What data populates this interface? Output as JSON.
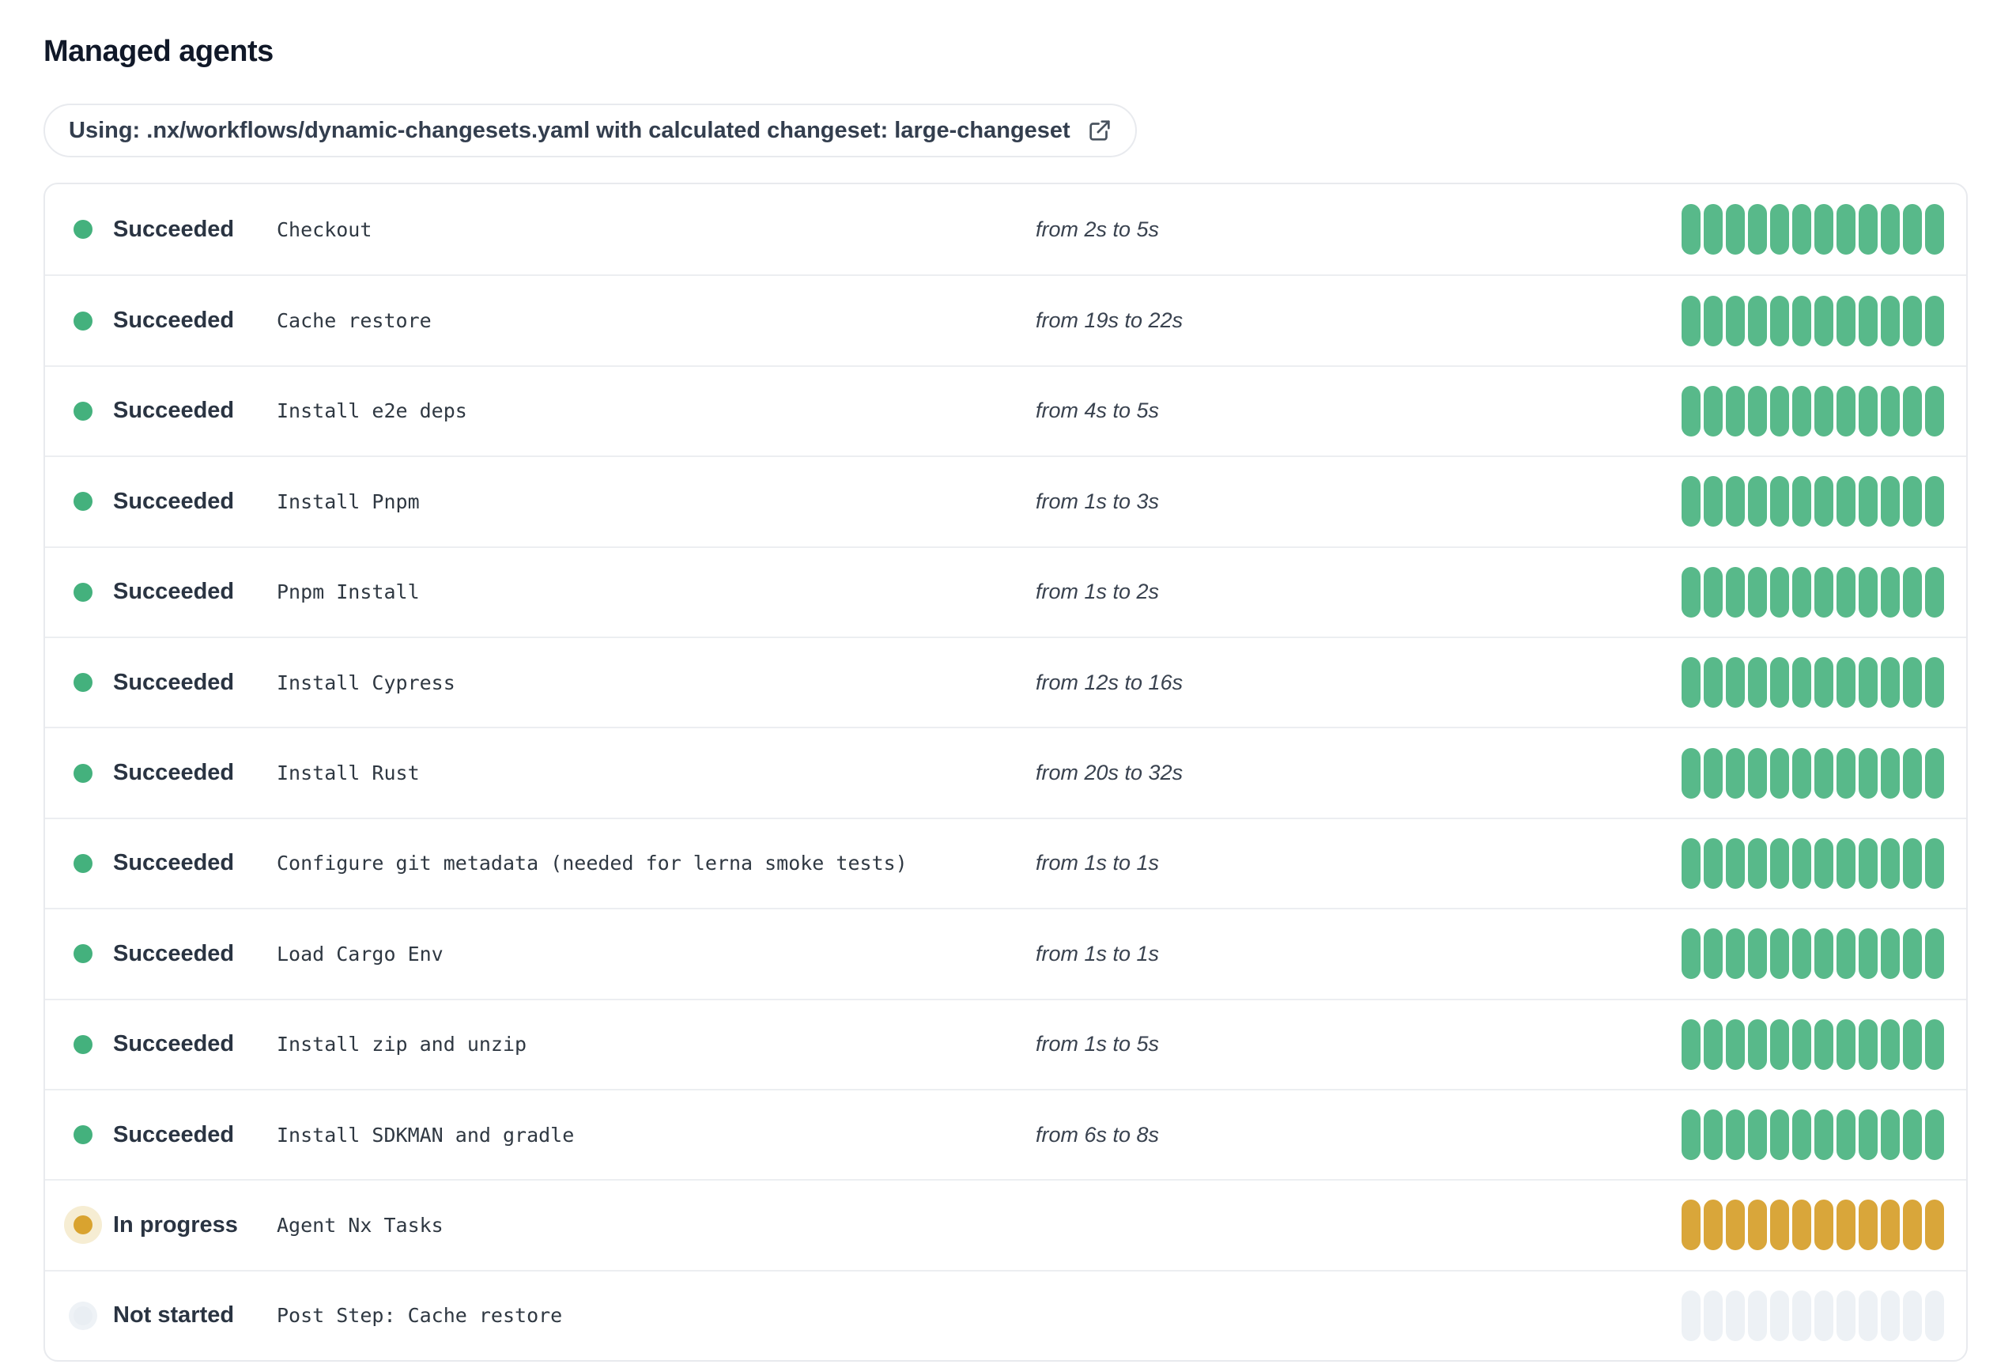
{
  "page": {
    "title": "Managed agents"
  },
  "workflow_badge": {
    "label": "Using: .nx/workflows/dynamic-changesets.yaml with calculated changeset: large-changeset",
    "icon": "external-link-icon"
  },
  "colors": {
    "title_text": "#101828",
    "badge_text": "#333E4E",
    "badge_border": "#E8EAEE",
    "panel_border": "#E8EAEE",
    "row_divider": "#ECEEF1",
    "status_text": "#2A3442",
    "step_text": "#2F3842",
    "duration_text": "#39424F",
    "succeeded_dot": "#44B17D",
    "succeeded_bar": "#58B98A",
    "in_progress_dot": "#D9A32F",
    "in_progress_halo": "#F6EDD3",
    "in_progress_bar": "#D9A63A",
    "not_started_dot": "#E9EEF3",
    "not_started_bar": "#EDF1F5"
  },
  "agents": {
    "segments_per_bar": 12,
    "rows": [
      {
        "status": "succeeded",
        "status_label": "Succeeded",
        "step": "Checkout",
        "duration": "from 2s to 5s"
      },
      {
        "status": "succeeded",
        "status_label": "Succeeded",
        "step": "Cache restore",
        "duration": "from 19s to 22s"
      },
      {
        "status": "succeeded",
        "status_label": "Succeeded",
        "step": "Install e2e deps",
        "duration": "from 4s to 5s"
      },
      {
        "status": "succeeded",
        "status_label": "Succeeded",
        "step": "Install Pnpm",
        "duration": "from 1s to 3s"
      },
      {
        "status": "succeeded",
        "status_label": "Succeeded",
        "step": "Pnpm Install",
        "duration": "from 1s to 2s"
      },
      {
        "status": "succeeded",
        "status_label": "Succeeded",
        "step": "Install Cypress",
        "duration": "from 12s to 16s"
      },
      {
        "status": "succeeded",
        "status_label": "Succeeded",
        "step": "Install Rust",
        "duration": "from 20s to 32s"
      },
      {
        "status": "succeeded",
        "status_label": "Succeeded",
        "step": "Configure git metadata (needed for lerna smoke tests)",
        "duration": "from 1s to 1s"
      },
      {
        "status": "succeeded",
        "status_label": "Succeeded",
        "step": "Load Cargo Env",
        "duration": "from 1s to 1s"
      },
      {
        "status": "succeeded",
        "status_label": "Succeeded",
        "step": "Install zip and unzip",
        "duration": "from 1s to 5s"
      },
      {
        "status": "succeeded",
        "status_label": "Succeeded",
        "step": "Install SDKMAN and gradle",
        "duration": "from 6s to 8s"
      },
      {
        "status": "in-progress",
        "status_label": "In progress",
        "step": "Agent Nx Tasks",
        "duration": ""
      },
      {
        "status": "not-started",
        "status_label": "Not started",
        "step": "Post Step: Cache restore",
        "duration": ""
      }
    ]
  }
}
